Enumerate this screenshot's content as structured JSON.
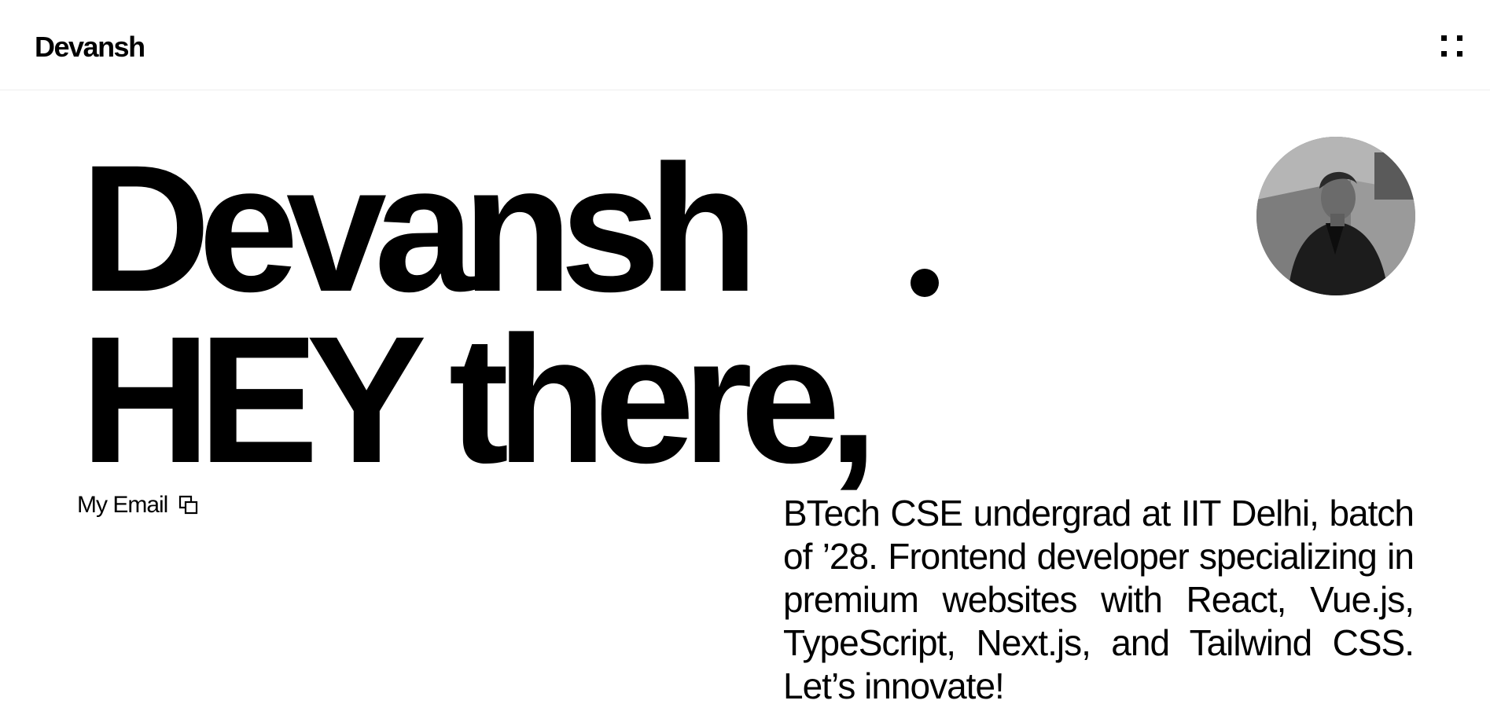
{
  "header": {
    "brand": "Devansh",
    "menu_icon": "grid-dots-icon"
  },
  "hero": {
    "line1": "Devansh",
    "line2": "HEY there,",
    "avatar_icon": "profile-photo"
  },
  "contact": {
    "email_label": "My Email",
    "email_icon": "copy-icon"
  },
  "bio": {
    "text": "BTech CSE undergrad at IIT Delhi, batch of ’28. Frontend developer specializing in premium websites with React, Vue.js, TypeScript, Next.js, and Tailwind CSS. Let’s innovate!"
  },
  "colors": {
    "background": "#ffffff",
    "text": "#000000"
  }
}
